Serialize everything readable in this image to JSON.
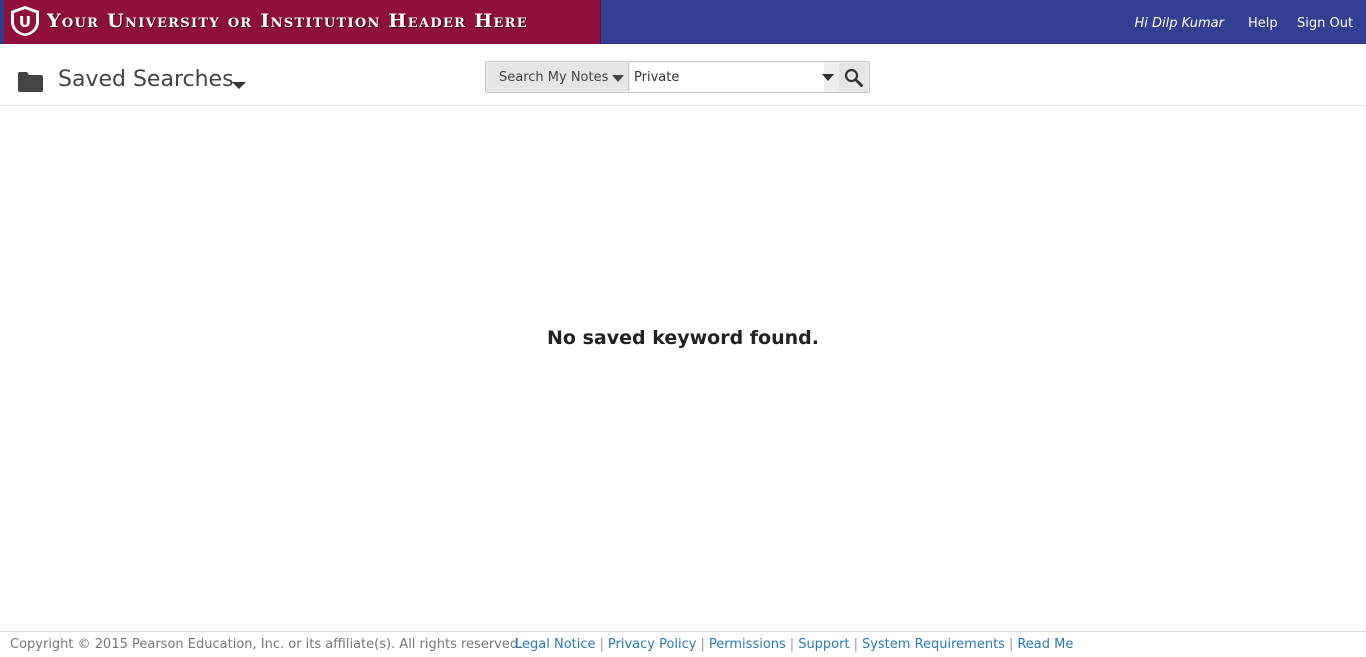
{
  "header": {
    "banner_text": "Your University or Institution Header Here",
    "shield_letter": "U",
    "greeting": "Hi Dilp Kumar",
    "help_label": "Help",
    "signout_label": "Sign Out",
    "colors": {
      "bar": "#343f93",
      "banner": "#8e0f3a"
    }
  },
  "subheader": {
    "title": "Saved Searches",
    "search": {
      "scope_label": "Search My Notes",
      "filter_value": "Private"
    }
  },
  "main": {
    "empty_message": "No saved keyword found."
  },
  "footer": {
    "copyright": "Copyright © 2015 Pearson Education, Inc. or its affiliate(s). All rights reserved.",
    "links": [
      "Legal Notice",
      "Privacy Policy",
      "Permissions",
      "Support",
      "System Requirements",
      "Read Me"
    ],
    "link_color": "#2b7ab8"
  }
}
